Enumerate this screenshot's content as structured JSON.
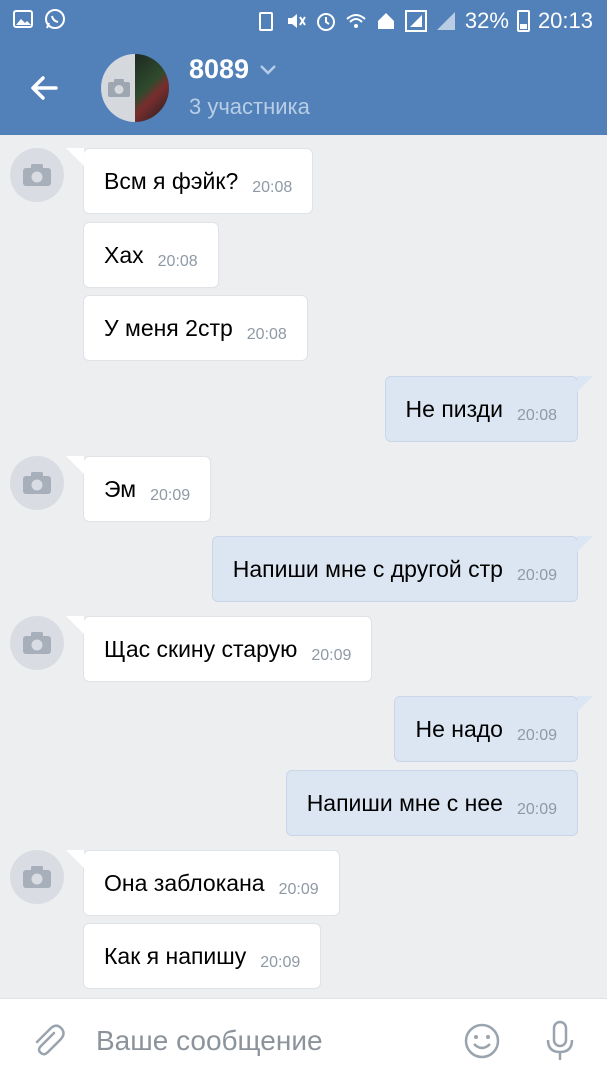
{
  "status_bar": {
    "battery": "32%",
    "time": "20:13"
  },
  "header": {
    "title": "8089",
    "subtitle": "3 участника"
  },
  "messages": [
    {
      "dir": "in",
      "text": "Всм я фэйк?",
      "time": "20:08"
    },
    {
      "dir": "in",
      "text": "Хах",
      "time": "20:08"
    },
    {
      "dir": "in",
      "text": "У меня 2стр",
      "time": "20:08"
    },
    {
      "dir": "out",
      "text": "Не пизди",
      "time": "20:08"
    },
    {
      "dir": "in",
      "text": "Эм",
      "time": "20:09"
    },
    {
      "dir": "out",
      "text": "Напиши мне с другой стр",
      "time": "20:09"
    },
    {
      "dir": "in",
      "text": "Щас скину старую",
      "time": "20:09"
    },
    {
      "dir": "out",
      "text": "Не надо",
      "time": "20:09"
    },
    {
      "dir": "out",
      "text": "Напиши мне с нее",
      "time": "20:09"
    },
    {
      "dir": "in",
      "text": "Она заблокана",
      "time": "20:09"
    },
    {
      "dir": "in",
      "text": "Как я напишу",
      "time": "20:09"
    }
  ],
  "composer": {
    "placeholder": "Ваше сообщение"
  },
  "icons": {
    "back": "arrow-left-icon",
    "attach": "paperclip-icon",
    "emoji": "smile-icon",
    "voice": "microphone-icon"
  },
  "colors": {
    "header": "#5181b8",
    "background": "#edeef0",
    "incoming_bubble": "#ffffff",
    "outgoing_bubble": "#dce6f3"
  }
}
